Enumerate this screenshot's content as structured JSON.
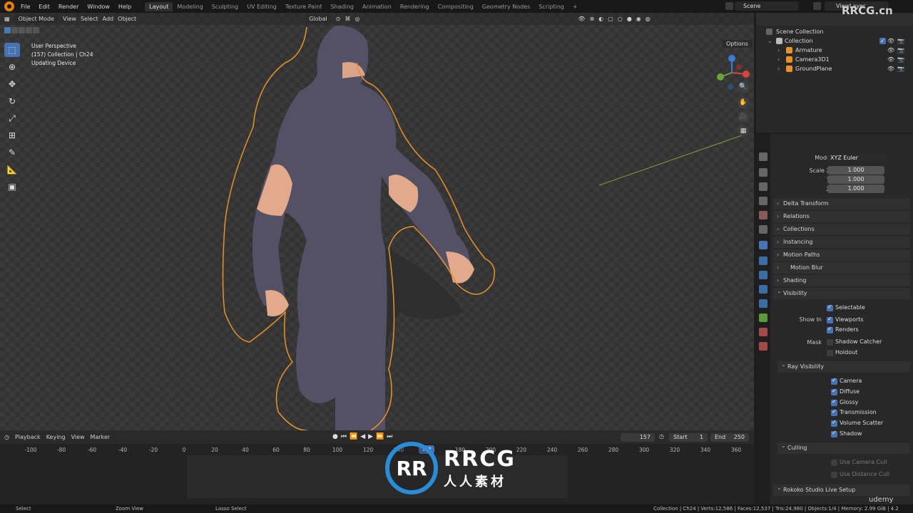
{
  "topbar": {
    "menu": [
      "File",
      "Edit",
      "Render",
      "Window",
      "Help"
    ],
    "workspaces": [
      "Layout",
      "Modeling",
      "Sculpting",
      "UV Editing",
      "Texture Paint",
      "Shading",
      "Animation",
      "Rendering",
      "Compositing",
      "Geometry Nodes",
      "Scripting"
    ],
    "active_workspace": "Layout",
    "plus": "+",
    "scene": "Scene",
    "view_layer": "ViewLayer"
  },
  "viewport": {
    "mode": "Object Mode",
    "menus": [
      "View",
      "Select",
      "Add",
      "Object"
    ],
    "transform": "Global",
    "info_lines": [
      "User Perspective",
      "(157) Collection | Ch24",
      "Updating Device"
    ],
    "options": "Options"
  },
  "outliner": {
    "scene_collection": "Scene Collection",
    "collection": "Collection",
    "items": [
      "Armature",
      "Camera3D1",
      "GroundPlane"
    ]
  },
  "properties": {
    "mode_label": "Mode",
    "mode_value": "XYZ Euler",
    "scale_label": "Scale X",
    "y_label": "Y",
    "z_label": "Z",
    "scale_values": [
      "1.000",
      "1.000",
      "1.000"
    ],
    "panels": [
      "Delta Transform",
      "Relations",
      "Collections",
      "Instancing",
      "Motion Paths",
      "Motion Blur",
      "Shading",
      "Visibility"
    ],
    "selectable": "Selectable",
    "show_in": "Show In",
    "viewports": "Viewports",
    "renders": "Renders",
    "mask": "Mask",
    "shadow_catcher": "Shadow Catcher",
    "holdout": "Holdout",
    "ray_visibility": "Ray Visibility",
    "rays": [
      "Camera",
      "Diffuse",
      "Glossy",
      "Transmission",
      "Volume Scatter",
      "Shadow"
    ],
    "culling": "Culling",
    "use_camera_cull": "Use Camera Cull",
    "use_distance_cull": "Use Distance Cull",
    "rokoko": "Rokoko Studio Live Setup"
  },
  "timeline": {
    "menus": [
      "Playback",
      "Keying",
      "View",
      "Marker"
    ],
    "current_frame": "157",
    "start_label": "Start",
    "start": "1",
    "end_label": "End",
    "end": "250",
    "ticks": [
      "-100",
      "-80",
      "-60",
      "-40",
      "-20",
      "0",
      "20",
      "40",
      "60",
      "80",
      "100",
      "120",
      "140",
      "160",
      "180",
      "200",
      "220",
      "240",
      "260",
      "280",
      "300",
      "320",
      "340",
      "360"
    ]
  },
  "statusbar": {
    "select": "Select",
    "zoom": "Zoom View",
    "lasso": "Lasso Select",
    "stats": "Collection | Ch24 | Verts:12,586 | Faces:12,537 | Tris:24,980 | Objects:1/4 | Memory: 2.99 GiB | 4.2"
  },
  "watermark": {
    "logo": "RR",
    "brand": "RRCG",
    "sub": "人人素材",
    "corner": "RRCG.cn",
    "udemy": "udemy"
  },
  "colors": {
    "accent": "#4772b3",
    "selection_outline": "#e8922a"
  }
}
